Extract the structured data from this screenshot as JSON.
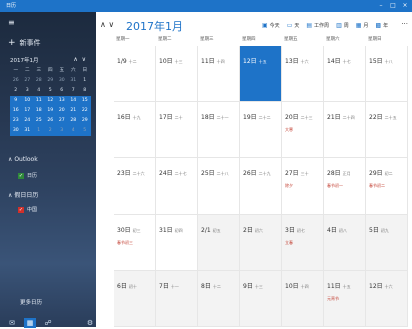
{
  "window": {
    "title": "日历"
  },
  "sidebar": {
    "new_event": "新事件",
    "mini_month": "2017年1月",
    "mini_dow": [
      "一",
      "二",
      "三",
      "四",
      "五",
      "六",
      "日"
    ],
    "mini_weeks": [
      [
        "26",
        "27",
        "28",
        "29",
        "30",
        "31",
        "1"
      ],
      [
        "2",
        "3",
        "4",
        "5",
        "6",
        "7",
        "8"
      ],
      [
        "9",
        "10",
        "11",
        "12",
        "13",
        "14",
        "15"
      ],
      [
        "16",
        "17",
        "18",
        "19",
        "20",
        "21",
        "22"
      ],
      [
        "23",
        "24",
        "25",
        "26",
        "27",
        "28",
        "29"
      ],
      [
        "30",
        "31",
        "1",
        "2",
        "3",
        "4",
        "5"
      ]
    ],
    "outlook_label": "Outlook",
    "outlook_cal": "日历",
    "holiday_label": "假日日历",
    "holiday_cal": "中国",
    "more": "更多日历"
  },
  "header": {
    "month": "2017年1月",
    "views": [
      "今天",
      "天",
      "工作周",
      "周",
      "月",
      "年"
    ]
  },
  "dow": [
    "星期一",
    "星期二",
    "星期三",
    "星期四",
    "星期五",
    "星期六",
    "星期日"
  ],
  "weeks": [
    [
      {
        "d": "1/9",
        "l": "十二"
      },
      {
        "d": "10日",
        "l": "十三"
      },
      {
        "d": "11日",
        "l": "十四"
      },
      {
        "d": "12日",
        "l": "十五"
      },
      {
        "d": "13日",
        "l": "十六"
      },
      {
        "d": "14日",
        "l": "十七"
      },
      {
        "d": "15日",
        "l": "十八"
      }
    ],
    [
      {
        "d": "16日",
        "l": "十九"
      },
      {
        "d": "17日",
        "l": "二十"
      },
      {
        "d": "18日",
        "l": "二十一"
      },
      {
        "d": "19日",
        "l": "二十二"
      },
      {
        "d": "20日",
        "l": "二十三",
        "e": "大寒"
      },
      {
        "d": "21日",
        "l": "二十四"
      },
      {
        "d": "22日",
        "l": "二十五"
      }
    ],
    [
      {
        "d": "23日",
        "l": "二十六"
      },
      {
        "d": "24日",
        "l": "二十七"
      },
      {
        "d": "25日",
        "l": "二十八"
      },
      {
        "d": "26日",
        "l": "二十九"
      },
      {
        "d": "27日",
        "l": "三十",
        "e": "除夕"
      },
      {
        "d": "28日",
        "l": "正月",
        "e": "春节初一"
      },
      {
        "d": "29日",
        "l": "初二",
        "e": "春节初二"
      }
    ],
    [
      {
        "d": "30日",
        "l": "初三",
        "e": "春节初三"
      },
      {
        "d": "31日",
        "l": "初四"
      },
      {
        "d": "2/1",
        "l": "初五"
      },
      {
        "d": "2日",
        "l": "初六"
      },
      {
        "d": "3日",
        "l": "初七",
        "e": "立春"
      },
      {
        "d": "4日",
        "l": "初八"
      },
      {
        "d": "5日",
        "l": "初九"
      }
    ],
    [
      {
        "d": "6日",
        "l": "初十"
      },
      {
        "d": "7日",
        "l": "十一"
      },
      {
        "d": "8日",
        "l": "十二"
      },
      {
        "d": "9日",
        "l": "十三"
      },
      {
        "d": "10日",
        "l": "十四"
      },
      {
        "d": "11日",
        "l": "十五",
        "e": "元宵节"
      },
      {
        "d": "12日",
        "l": "十六"
      }
    ]
  ]
}
